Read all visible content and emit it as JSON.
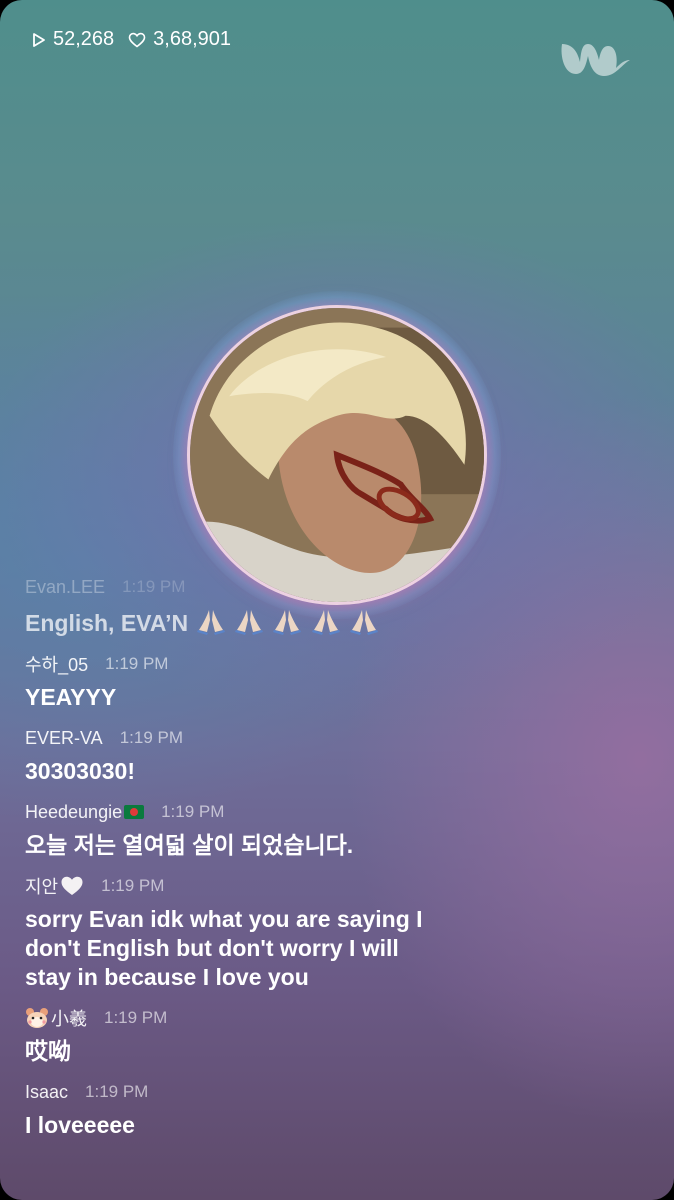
{
  "stats": {
    "plays": "52,268",
    "likes": "3,68,901"
  },
  "logo": {
    "label": "w",
    "icon": "weverse-logo"
  },
  "avatar": {
    "icon": "profile-photo"
  },
  "chat": {
    "messages": [
      {
        "user": "Evan.LEE",
        "time": "1:19 PM",
        "text": "English, EVA’N",
        "emoji": "folded-hands x5"
      },
      {
        "user": "수하_05",
        "time": "1:19 PM",
        "text": "YEAYYY"
      },
      {
        "user": "EVER-VA",
        "time": "1:19 PM",
        "text": "30303030!"
      },
      {
        "user": "Heedeungie",
        "time": "1:19 PM",
        "text": "오늘 저는 열여덟 살이 되었습니다.",
        "emoji": "bangladesh-flag"
      },
      {
        "user": "지안",
        "time": "1:19 PM",
        "text_lines": [
          "sorry Evan idk what you are saying I",
          "don't English but don't worry I will",
          "stay in because I love you"
        ],
        "emoji": "white-heart"
      },
      {
        "user": "小羲",
        "time": "1:19 PM",
        "text": "哎呦",
        "emoji": "hamster-face"
      },
      {
        "user": "Isaac",
        "time": "1:19 PM",
        "text": "I loveeeee"
      }
    ]
  },
  "colors": {
    "bg_top": "#4f8e8c",
    "bg_mid": "#6f6e9a",
    "bg_bottom": "#5e4a6a",
    "text": "#ffffff"
  }
}
